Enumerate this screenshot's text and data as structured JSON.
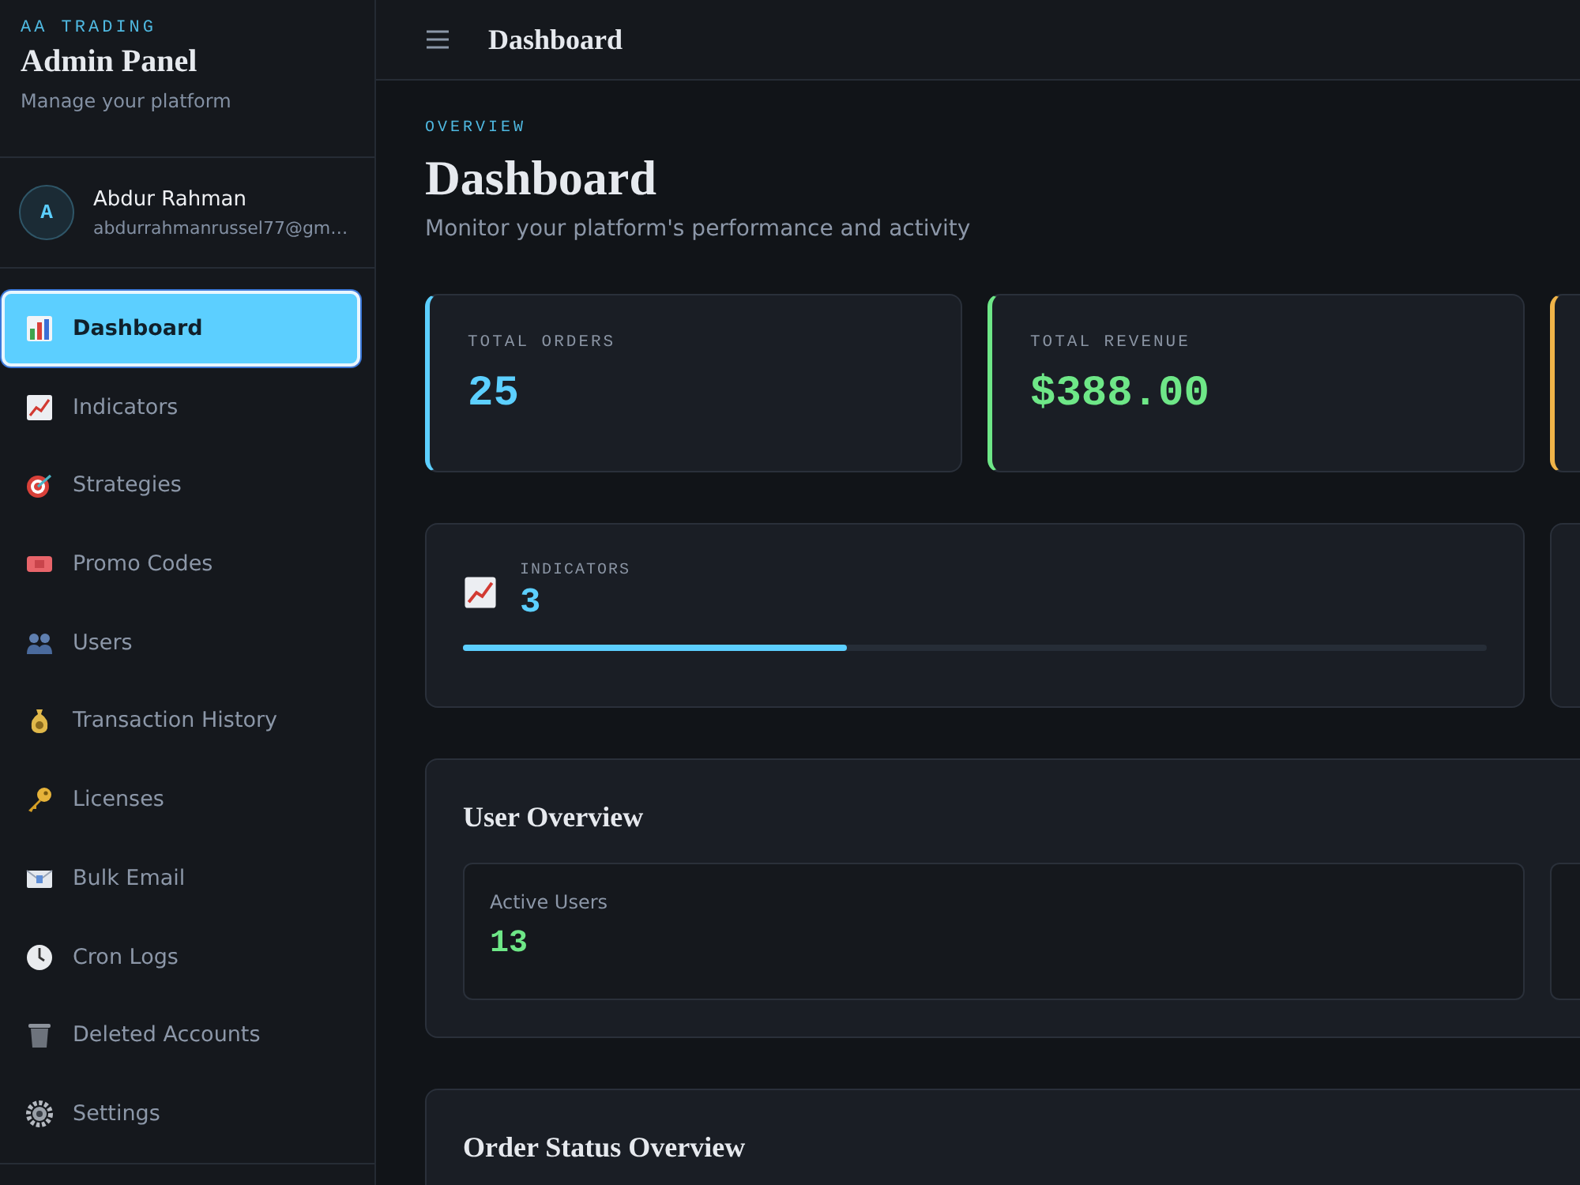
{
  "brand": {
    "kicker": "AA TRADING",
    "title": "Admin Panel",
    "subtitle": "Manage your platform"
  },
  "user": {
    "initial": "A",
    "name": "Abdur Rahman",
    "email": "abdurrahmanrussel77@gm…"
  },
  "nav": [
    {
      "label": "Dashboard",
      "kind": "bars",
      "selected": true
    },
    {
      "label": "Indicators",
      "kind": "trend",
      "selected": false
    },
    {
      "label": "Strategies",
      "kind": "target",
      "selected": false
    },
    {
      "label": "Promo Codes",
      "kind": "ticket",
      "selected": false
    },
    {
      "label": "Users",
      "kind": "users",
      "selected": false
    },
    {
      "label": "Transaction History",
      "kind": "moneybag",
      "selected": false
    },
    {
      "label": "Licenses",
      "kind": "key",
      "selected": false
    },
    {
      "label": "Bulk Email",
      "kind": "mail",
      "selected": false
    },
    {
      "label": "Cron Logs",
      "kind": "clock",
      "selected": false
    },
    {
      "label": "Deleted Accounts",
      "kind": "trash",
      "selected": false
    },
    {
      "label": "Settings",
      "kind": "gear",
      "selected": false
    }
  ],
  "topbar": {
    "title": "Dashboard"
  },
  "page": {
    "eyebrow": "OVERVIEW",
    "title": "Dashboard",
    "subtitle": "Monitor your platform's performance and activity"
  },
  "stats": [
    {
      "label": "TOTAL ORDERS",
      "value": "25",
      "color": "#5ccfff"
    },
    {
      "label": "TOTAL REVENUE",
      "value": "$388.00",
      "color": "#6ee787"
    },
    {
      "color": "#f0b449"
    }
  ],
  "metrics": [
    {
      "label": "INDICATORS",
      "value": "3",
      "kind": "trend",
      "level": 0.375
    }
  ],
  "user_overview": {
    "title": "User Overview",
    "cards": [
      {
        "label": "Active Users",
        "value": "13"
      }
    ]
  },
  "order_status": {
    "title": "Order Status Overview"
  }
}
